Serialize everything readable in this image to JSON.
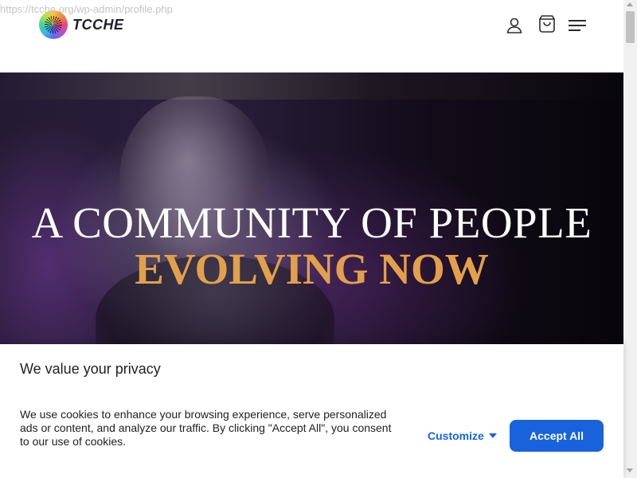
{
  "url_overlay": "https://tcche.org/wp-admin/profile.php",
  "header": {
    "brand": "TCCHE",
    "icons": [
      "user-icon",
      "shopping-bag-icon",
      "hamburger-menu-icon"
    ]
  },
  "hero": {
    "line1": "A COMMUNITY OF PEOPLE",
    "line2": "EVOLVING NOW",
    "accent_color": "#e3a04a"
  },
  "privacy_banner": {
    "title": "We value your privacy",
    "text": "We use cookies to enhance your browsing experience, serve personalized ads or content, and analyze our traffic. By clicking \"Accept All\", you consent to our use of cookies.",
    "customize_label": "Customize",
    "accept_label": "Accept All",
    "button_color": "#1863dc"
  }
}
